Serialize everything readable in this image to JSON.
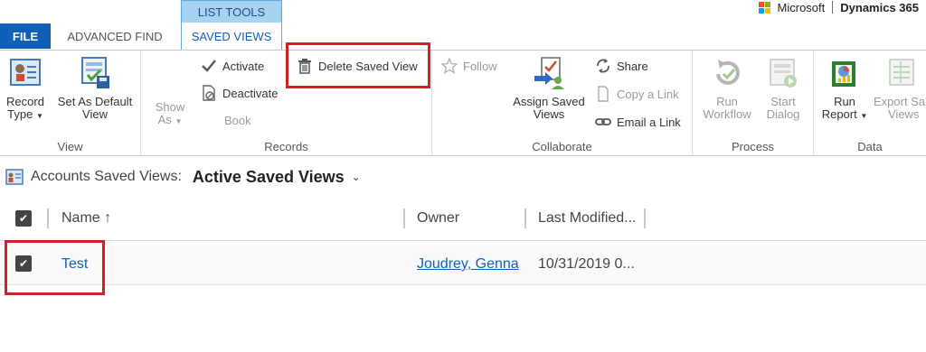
{
  "tabs": {
    "file": "FILE",
    "advanced_find": "ADVANCED FIND",
    "context_group": "LIST TOOLS",
    "saved_views": "SAVED VIEWS"
  },
  "brand": {
    "company": "Microsoft",
    "product": "Dynamics 365"
  },
  "ribbon": {
    "view": {
      "label": "View",
      "record_type": [
        "Record",
        "Type"
      ],
      "set_default": [
        "Set As Default",
        "View"
      ]
    },
    "records": {
      "label": "Records",
      "show_as": [
        "Show",
        "As"
      ],
      "activate": "Activate",
      "deactivate": "Deactivate",
      "book": "Book",
      "delete_saved_view": "Delete Saved View"
    },
    "collaborate": {
      "label": "Collaborate",
      "follow": "Follow",
      "assign_saved_views": [
        "Assign Saved",
        "Views"
      ],
      "share": "Share",
      "copy_link": "Copy a Link",
      "email_link": "Email a Link"
    },
    "process": {
      "label": "Process",
      "run_workflow": [
        "Run",
        "Workflow"
      ],
      "start_dialog": [
        "Start",
        "Dialog"
      ]
    },
    "data": {
      "label": "Data",
      "run_report": [
        "Run",
        "Report"
      ],
      "export_saved_views": [
        "Export Sa",
        "Views"
      ]
    }
  },
  "view_header": {
    "entity": "Accounts Saved Views:",
    "selected_view": "Active Saved Views"
  },
  "grid": {
    "columns": [
      "Name ↑",
      "Owner",
      "Last Modified..."
    ],
    "rows": [
      {
        "name": "Test",
        "owner": "Joudrey, Genna",
        "modified": "10/31/2019 0..."
      }
    ]
  },
  "icons": [
    "record-type-icon",
    "set-default-view-icon",
    "activate-icon",
    "deactivate-icon",
    "delete-icon",
    "follow-icon",
    "assign-icon",
    "share-icon",
    "copy-link-icon",
    "email-link-icon",
    "run-workflow-icon",
    "start-dialog-icon",
    "run-report-icon",
    "export-icon"
  ]
}
